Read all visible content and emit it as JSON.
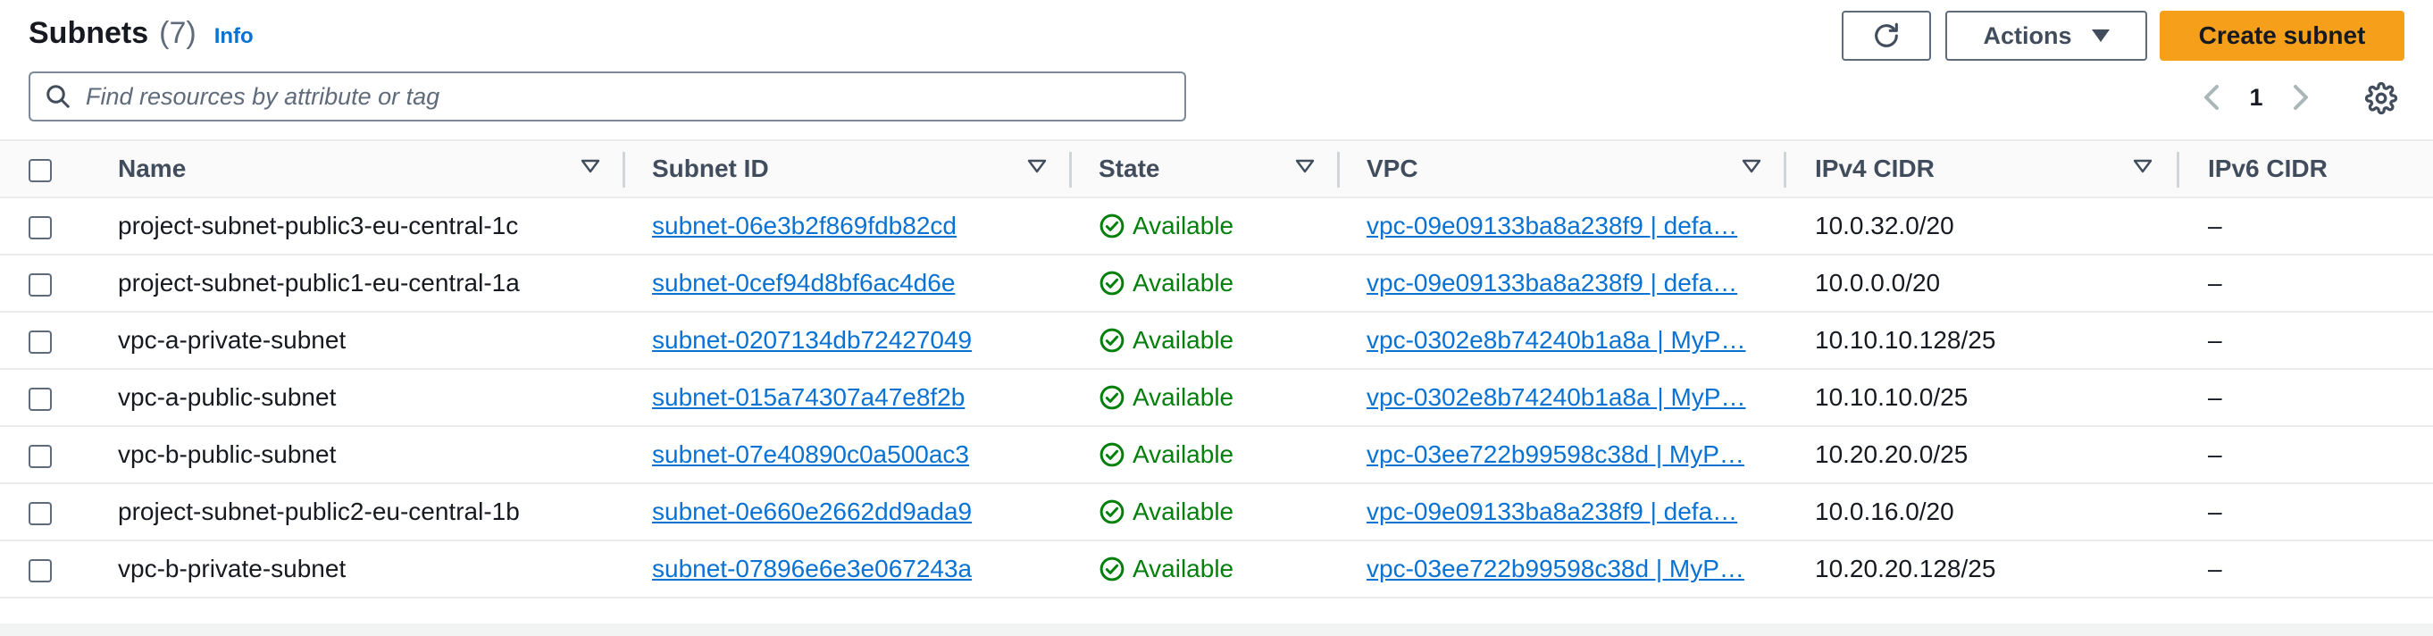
{
  "header": {
    "title": "Subnets",
    "count": "(7)",
    "info": "Info"
  },
  "actions": {
    "actions_label": "Actions",
    "create_label": "Create subnet"
  },
  "search": {
    "placeholder": "Find resources by attribute or tag"
  },
  "pager": {
    "page": "1"
  },
  "columns": {
    "name": "Name",
    "subnet_id": "Subnet ID",
    "state": "State",
    "vpc": "VPC",
    "ipv4": "IPv4 CIDR",
    "ipv6": "IPv6 CIDR"
  },
  "rows": [
    {
      "name": "project-subnet-public3-eu-central-1c",
      "subnet_id": "subnet-06e3b2f869fdb82cd",
      "state": "Available",
      "vpc": "vpc-09e09133ba8a238f9 | defa…",
      "ipv4": "10.0.32.0/20",
      "ipv6": "–"
    },
    {
      "name": "project-subnet-public1-eu-central-1a",
      "subnet_id": "subnet-0cef94d8bf6ac4d6e",
      "state": "Available",
      "vpc": "vpc-09e09133ba8a238f9 | defa…",
      "ipv4": "10.0.0.0/20",
      "ipv6": "–"
    },
    {
      "name": "vpc-a-private-subnet",
      "subnet_id": "subnet-0207134db72427049",
      "state": "Available",
      "vpc": "vpc-0302e8b74240b1a8a | MyP…",
      "ipv4": "10.10.10.128/25",
      "ipv6": "–"
    },
    {
      "name": "vpc-a-public-subnet",
      "subnet_id": "subnet-015a74307a47e8f2b",
      "state": "Available",
      "vpc": "vpc-0302e8b74240b1a8a | MyP…",
      "ipv4": "10.10.10.0/25",
      "ipv6": "–"
    },
    {
      "name": "vpc-b-public-subnet",
      "subnet_id": "subnet-07e40890c0a500ac3",
      "state": "Available",
      "vpc": "vpc-03ee722b99598c38d | MyP…",
      "ipv4": "10.20.20.0/25",
      "ipv6": "–"
    },
    {
      "name": "project-subnet-public2-eu-central-1b",
      "subnet_id": "subnet-0e660e2662dd9ada9",
      "state": "Available",
      "vpc": "vpc-09e09133ba8a238f9 | defa…",
      "ipv4": "10.0.16.0/20",
      "ipv6": "–"
    },
    {
      "name": "vpc-b-private-subnet",
      "subnet_id": "subnet-07896e6e3e067243a",
      "state": "Available",
      "vpc": "vpc-03ee722b99598c38d | MyP…",
      "ipv4": "10.20.20.128/25",
      "ipv6": "–"
    }
  ],
  "colors": {
    "link": "#0972d3",
    "success": "#037f0c",
    "primary_button": "#f59f1b"
  },
  "icons": {
    "refresh": "refresh-icon",
    "search": "search-icon",
    "settings": "gear-icon",
    "status": "check-circle-icon",
    "sort": "sort-caret-icon"
  }
}
